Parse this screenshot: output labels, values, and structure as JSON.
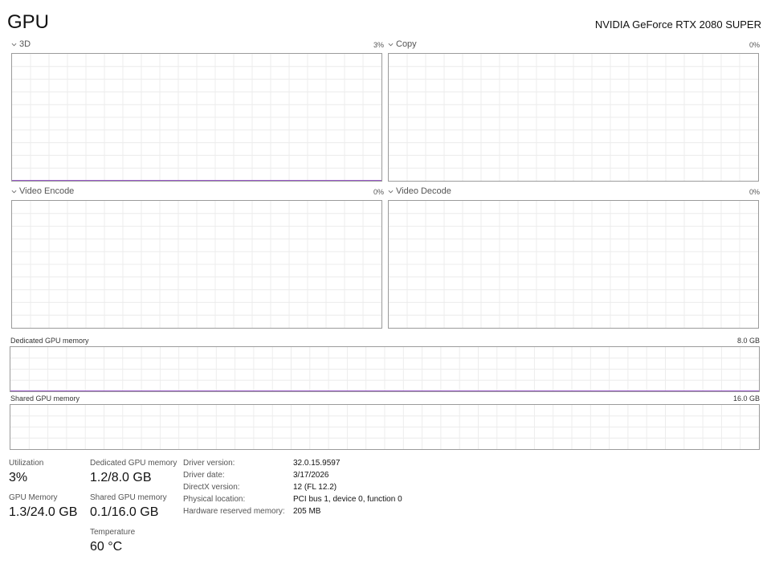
{
  "header": {
    "title": "GPU",
    "gpu_name": "NVIDIA GeForce RTX 2080 SUPER"
  },
  "engines": [
    {
      "label": "3D",
      "value": "3%"
    },
    {
      "label": "Copy",
      "value": "0%"
    },
    {
      "label": "Video Encode",
      "value": "0%"
    },
    {
      "label": "Video Decode",
      "value": "0%"
    }
  ],
  "memory_graphs": {
    "dedicated": {
      "label": "Dedicated GPU memory",
      "max": "8.0 GB"
    },
    "shared": {
      "label": "Shared GPU memory",
      "max": "16.0 GB"
    }
  },
  "chart_data": [
    {
      "type": "area",
      "series": [
        {
          "name": "3D",
          "values": [
            0,
            0,
            0,
            0,
            0,
            0,
            0,
            0,
            0,
            0,
            0,
            0,
            0,
            0,
            0,
            0,
            0,
            0,
            0,
            0,
            0,
            0,
            0,
            0,
            0,
            0,
            0,
            0,
            0,
            0,
            0,
            0,
            0,
            0,
            0,
            0,
            0,
            0,
            0,
            0,
            0,
            0,
            0,
            0,
            0,
            0,
            0,
            0,
            0,
            0,
            0,
            0,
            0,
            0,
            0,
            0,
            0,
            0,
            0,
            0,
            0,
            0,
            0,
            0,
            0,
            0,
            0,
            0,
            0,
            0,
            0,
            0,
            0,
            0,
            0,
            0,
            0,
            0,
            0,
            0,
            0,
            0,
            0,
            0,
            0,
            0,
            0,
            0,
            0,
            0,
            0,
            0,
            0,
            0,
            0,
            0,
            0,
            0,
            0,
            0
          ]
        }
      ],
      "ylim": [
        0,
        100
      ]
    },
    {
      "type": "area",
      "series": [
        {
          "name": "Dedicated GPU memory",
          "values": [
            0,
            0,
            0,
            0,
            0,
            0,
            0,
            0,
            0,
            0,
            0,
            0,
            0,
            0,
            0,
            0,
            0,
            0,
            0,
            0,
            0,
            0,
            0,
            0,
            0,
            0,
            0,
            0,
            0,
            0,
            0,
            0,
            0,
            0,
            0,
            0,
            0,
            0,
            0,
            0,
            0,
            0,
            0,
            0,
            0,
            0,
            0,
            0,
            0,
            0,
            0,
            0,
            0,
            0,
            0,
            0,
            0,
            0,
            0,
            0,
            0,
            0,
            0,
            0,
            0,
            0,
            0,
            0,
            0,
            0,
            0,
            0,
            0,
            0,
            0,
            0,
            0,
            0,
            0,
            0,
            0,
            0,
            0,
            0,
            0,
            0,
            0,
            0,
            0,
            0,
            0,
            0,
            0,
            0,
            0,
            0,
            0,
            0,
            0,
            0
          ]
        }
      ],
      "ylim": [
        0,
        8
      ]
    }
  ],
  "stats": {
    "utilization_label": "Utilization",
    "utilization_value": "3%",
    "gpu_memory_label": "GPU Memory",
    "gpu_memory_value": "1.3/24.0 GB",
    "dedicated_label": "Dedicated GPU memory",
    "dedicated_value": "1.2/8.0 GB",
    "shared_label": "Shared GPU memory",
    "shared_value": "0.1/16.0 GB",
    "temperature_label": "Temperature",
    "temperature_value": "60 °C"
  },
  "info": [
    {
      "key": "Driver version:",
      "value": "32.0.15.9597"
    },
    {
      "key": "Driver date:",
      "value": "3/17/2026"
    },
    {
      "key": "DirectX version:",
      "value": "12 (FL 12.2)"
    },
    {
      "key": "Physical location:",
      "value": "PCI bus 1, device 0, function 0"
    },
    {
      "key": "Hardware reserved memory:",
      "value": "205 MB"
    }
  ],
  "colors": {
    "line": "#9a5cc8",
    "fill": "#efe3f8",
    "grid": "#ececec",
    "border": "#9b9b9b"
  }
}
